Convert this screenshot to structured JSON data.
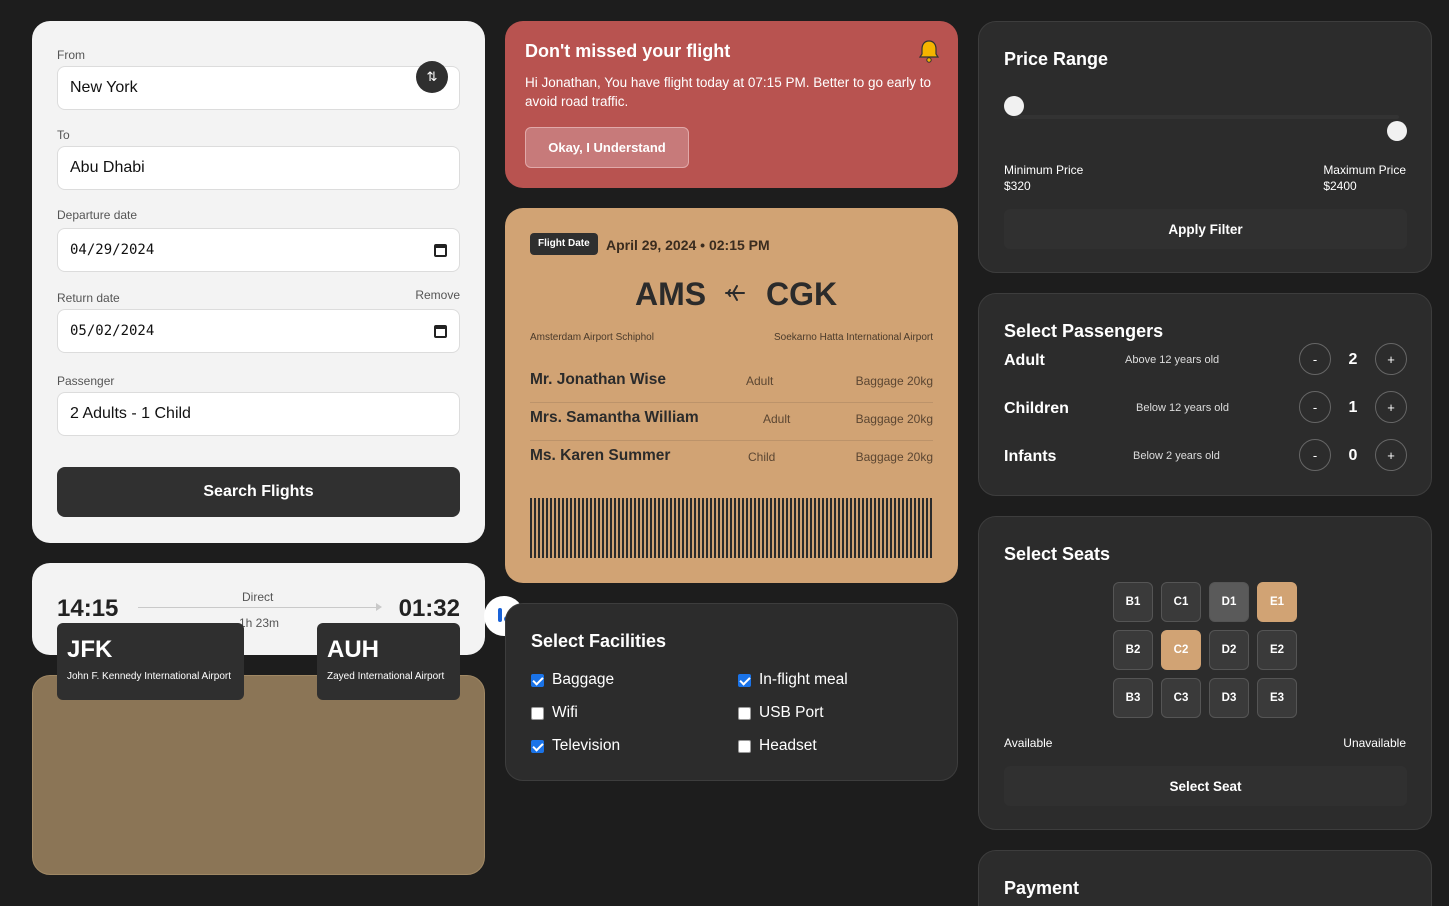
{
  "search_form": {
    "from_label": "From",
    "from_value": "New York",
    "to_label": "To",
    "to_value": "Abu Dhabi",
    "departure_label": "Departure date",
    "departure_value": "04/29/2024",
    "return_label": "Return date",
    "return_remove": "Remove",
    "return_value": "05/02/2024",
    "passenger_label": "Passenger",
    "passenger_value": "2 Adults - 1 Child",
    "search_button": "Search Flights"
  },
  "route": {
    "depart_time": "14:15",
    "arrive_time": "01:32",
    "type": "Direct",
    "duration": "1h 23m",
    "from_code": "JFK",
    "from_name": "John F. Kennedy International Airport",
    "to_code": "AUH",
    "to_name": "Zayed International Airport"
  },
  "alert": {
    "title": "Don't missed your flight",
    "message": "Hi Jonathan, You have flight today at 07:15 PM. Better to go early to avoid road traffic.",
    "button": "Okay, I Understand",
    "icon": "bell-icon",
    "bg_color": "#b85350"
  },
  "ticket": {
    "tag": "Flight Date",
    "datetime": "April 29, 2024 • 02:15 PM",
    "from_code": "AMS",
    "to_code": "CGK",
    "from_airport": "Amsterdam Airport Schiphol",
    "to_airport": "Soekarno Hatta International Airport",
    "passengers": [
      {
        "name": "Mr. Jonathan Wise",
        "type": "Adult",
        "baggage": "Baggage 20kg"
      },
      {
        "name": "Mrs. Samantha William",
        "type": "Adult",
        "baggage": "Baggage 20kg"
      },
      {
        "name": "Ms. Karen Summer",
        "type": "Child",
        "baggage": "Baggage 20kg"
      }
    ],
    "bg_color": "#d1a374"
  },
  "facilities": {
    "title": "Select Facilities",
    "items": [
      {
        "label": "Baggage",
        "checked": true
      },
      {
        "label": "In-flight meal",
        "checked": true
      },
      {
        "label": "Wifi",
        "checked": false
      },
      {
        "label": "USB Port",
        "checked": false
      },
      {
        "label": "Television",
        "checked": true
      },
      {
        "label": "Headset",
        "checked": false
      }
    ]
  },
  "price_range": {
    "title": "Price Range",
    "min_label": "Minimum Price",
    "min_value": "$320",
    "max_label": "Maximum Price",
    "max_value": "$2400",
    "button": "Apply Filter"
  },
  "passengers": {
    "title": "Select Passengers",
    "rows": [
      {
        "label": "Adult",
        "desc": "Above 12 years old",
        "count": "2",
        "minus": "-",
        "plus": "+"
      },
      {
        "label": "Children",
        "desc": "Below 12 years old",
        "count": "1",
        "minus": "-",
        "plus": "+"
      },
      {
        "label": "Infants",
        "desc": "Below 2 years old",
        "count": "0",
        "minus": "-",
        "plus": "+"
      }
    ]
  },
  "seats": {
    "title": "Select Seats",
    "rows": [
      [
        "B1",
        "C1",
        "D1",
        "E1"
      ],
      [
        "B2",
        "C2",
        "D2",
        "E2"
      ],
      [
        "B3",
        "C3",
        "D3",
        "E3"
      ]
    ],
    "available_label": "Available",
    "unavailable_label": "Unavailable",
    "button": "Select Seat"
  },
  "payment": {
    "title": "Payment"
  }
}
